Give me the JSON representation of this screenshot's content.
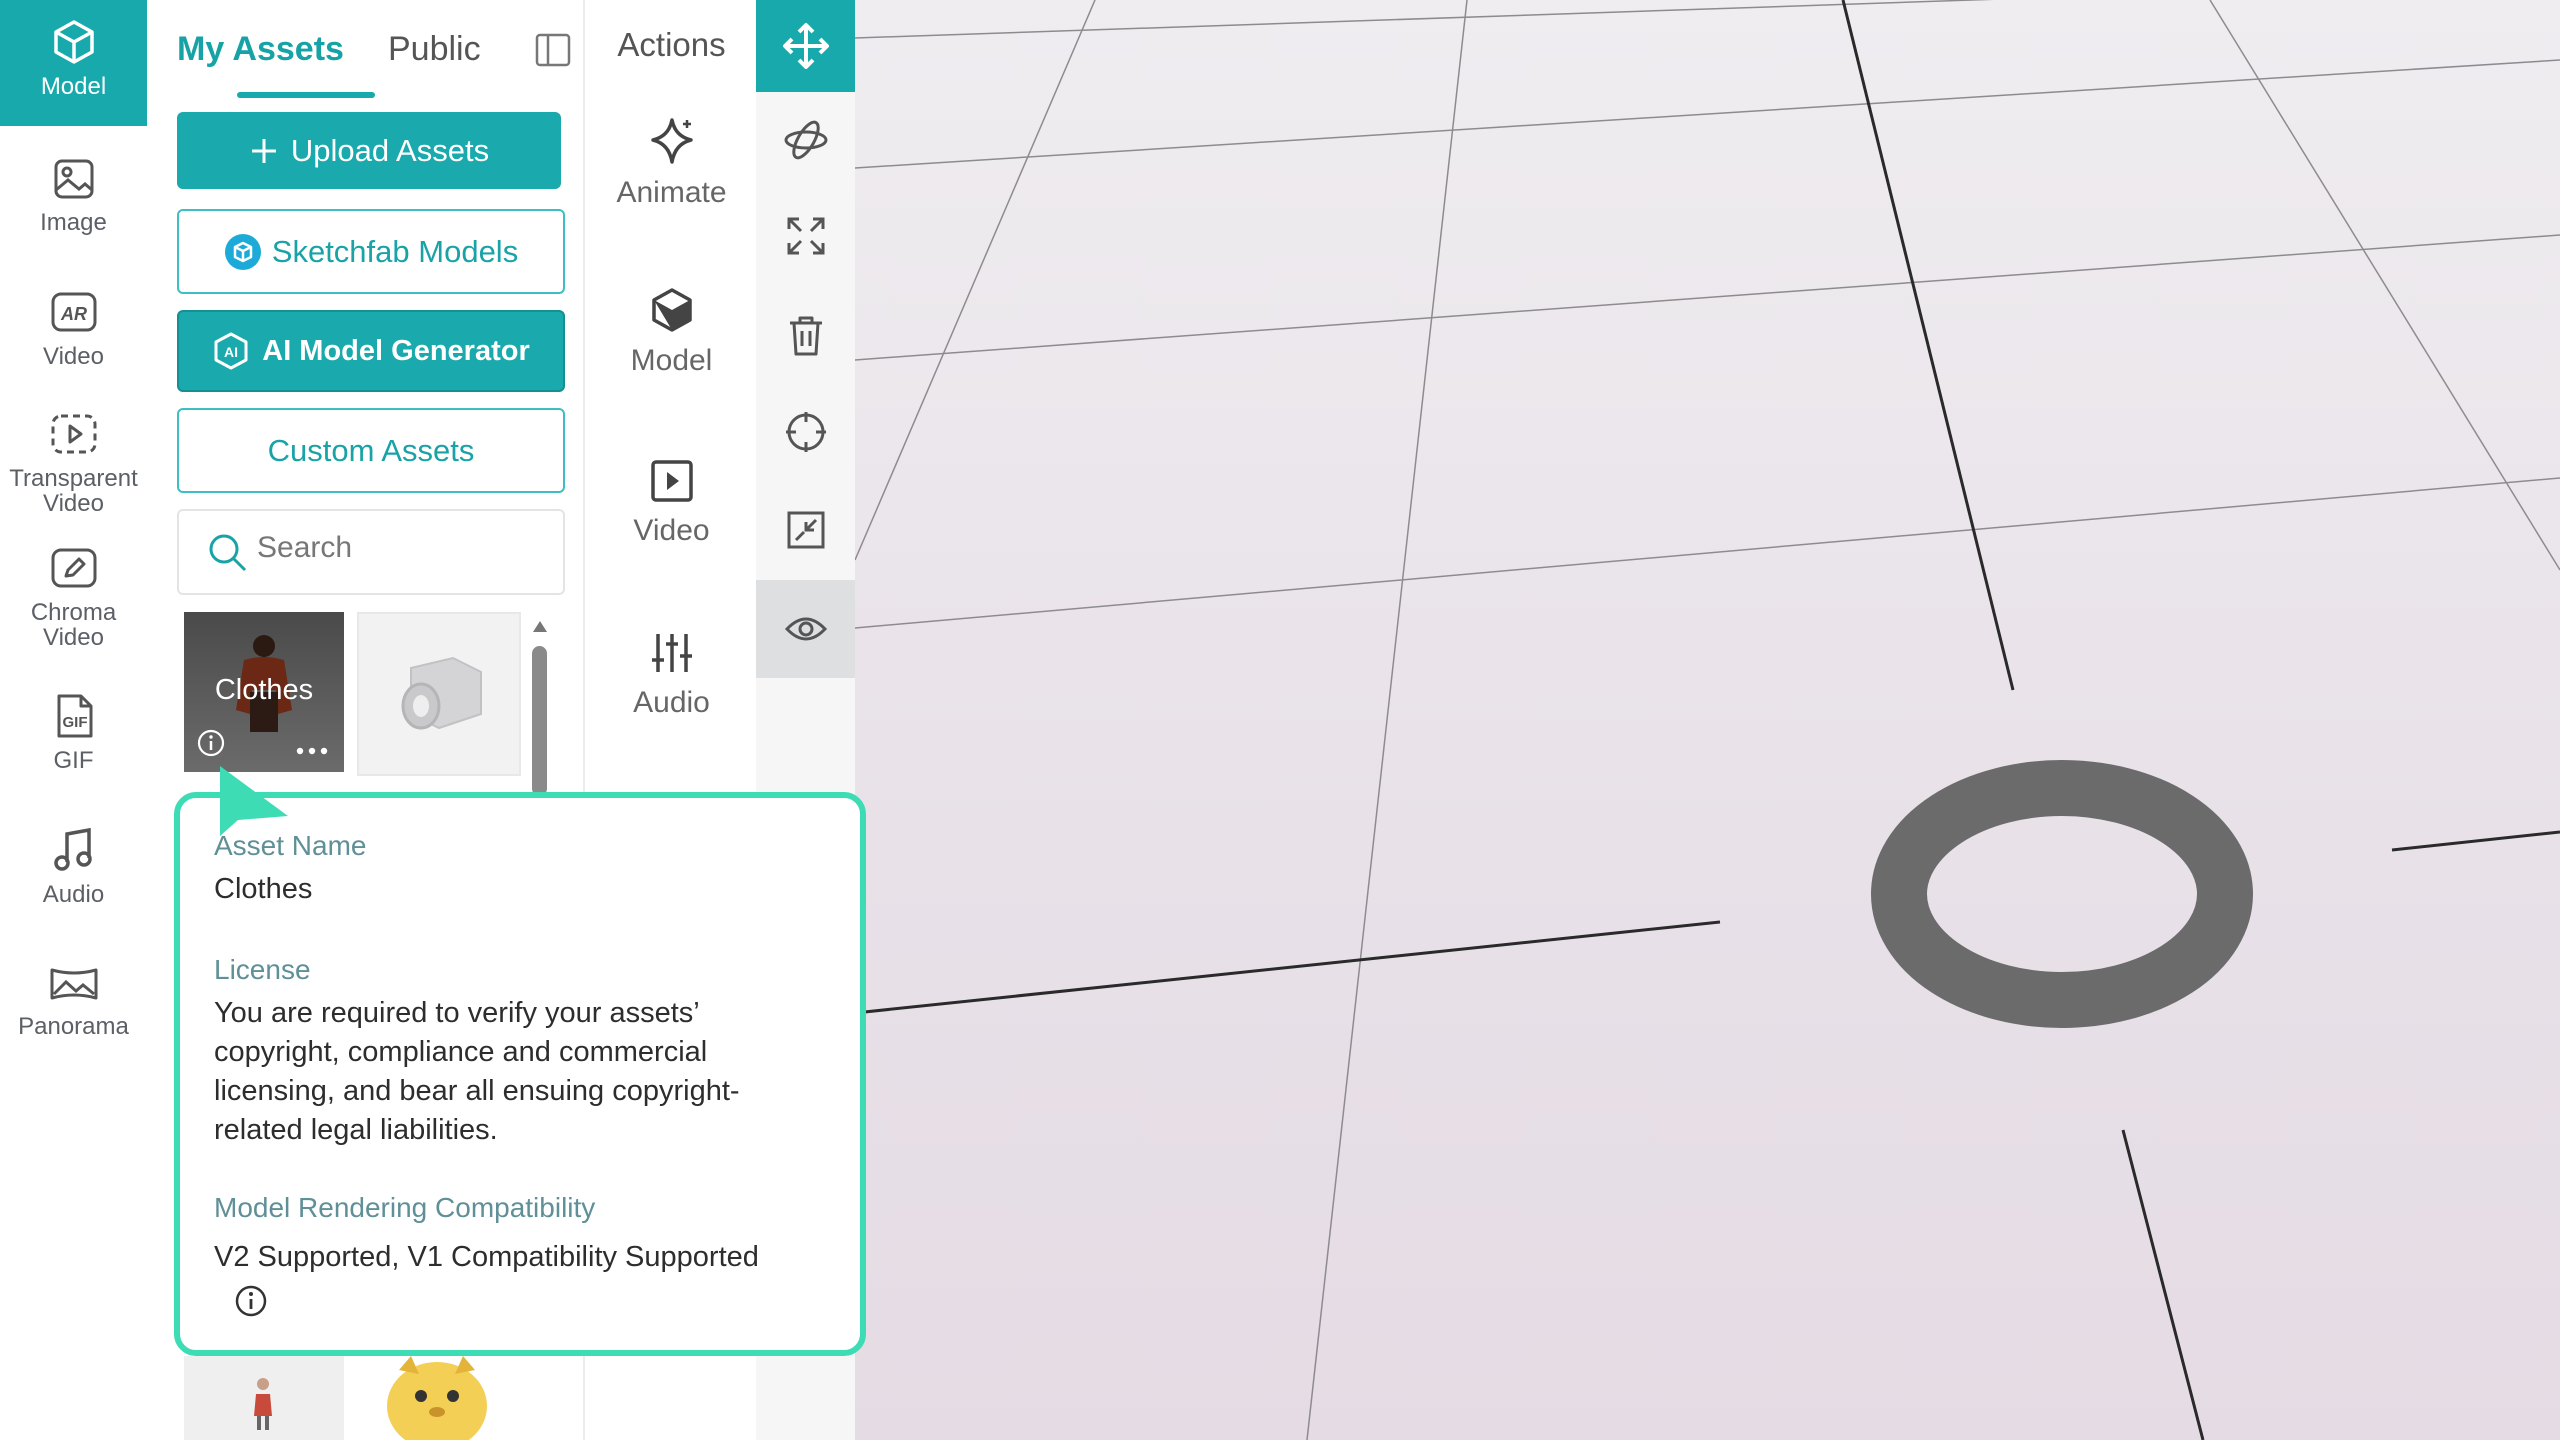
{
  "rail": {
    "items": [
      {
        "label": "Model",
        "icon": "cube-icon",
        "active": true
      },
      {
        "label": "Image",
        "icon": "image-icon"
      },
      {
        "label": "Video",
        "icon": "ar-video-icon"
      },
      {
        "label_line1": "Transparent",
        "label_line2": "Video",
        "icon": "transparent-video-icon"
      },
      {
        "label_line1": "Chroma",
        "label_line2": "Video",
        "icon": "chroma-video-icon"
      },
      {
        "label": "GIF",
        "icon": "gif-icon"
      },
      {
        "label": "Audio",
        "icon": "music-note-icon"
      },
      {
        "label": "Panorama",
        "icon": "panorama-icon"
      }
    ]
  },
  "panel": {
    "tabs": [
      {
        "label": "My Assets",
        "active": true
      },
      {
        "label": "Public",
        "active": false
      }
    ],
    "buttons": {
      "upload": "Upload Assets",
      "sketchfab": "Sketchfab Models",
      "ai_generator": "AI Model Generator",
      "custom": "Custom Assets"
    },
    "search_placeholder": "Search",
    "assets": [
      {
        "name": "Clothes"
      }
    ]
  },
  "actions": {
    "title": "Actions",
    "items": [
      {
        "label": "Animate",
        "icon": "sparkle-icon"
      },
      {
        "label": "Model",
        "icon": "model-cube-icon"
      },
      {
        "label": "Video",
        "icon": "play-square-icon"
      },
      {
        "label": "Audio",
        "icon": "sliders-icon"
      }
    ]
  },
  "tools": [
    {
      "icon": "move-icon",
      "active": true
    },
    {
      "icon": "rotate-icon"
    },
    {
      "icon": "expand-icon"
    },
    {
      "icon": "trash-icon"
    },
    {
      "icon": "crosshair-icon"
    },
    {
      "icon": "shrink-icon"
    },
    {
      "icon": "eye-icon",
      "selected": true
    }
  ],
  "popup": {
    "asset_name_label": "Asset Name",
    "asset_name": "Clothes",
    "license_label": "License",
    "license_text_1": "You are required to verify your assets’",
    "license_text_2": "copyright, compliance and commercial",
    "license_text_3": "licensing, and bear all ensuing copyright-",
    "license_text_4": "related legal liabilities.",
    "compat_label": "Model Rendering Compatibility",
    "compat_value": "V2 Supported, V1 Compatibility Supported"
  },
  "colors": {
    "accent": "#17a9ac",
    "popup_border": "#3ddcb4",
    "viewport_bg": "#ebe5ea"
  }
}
